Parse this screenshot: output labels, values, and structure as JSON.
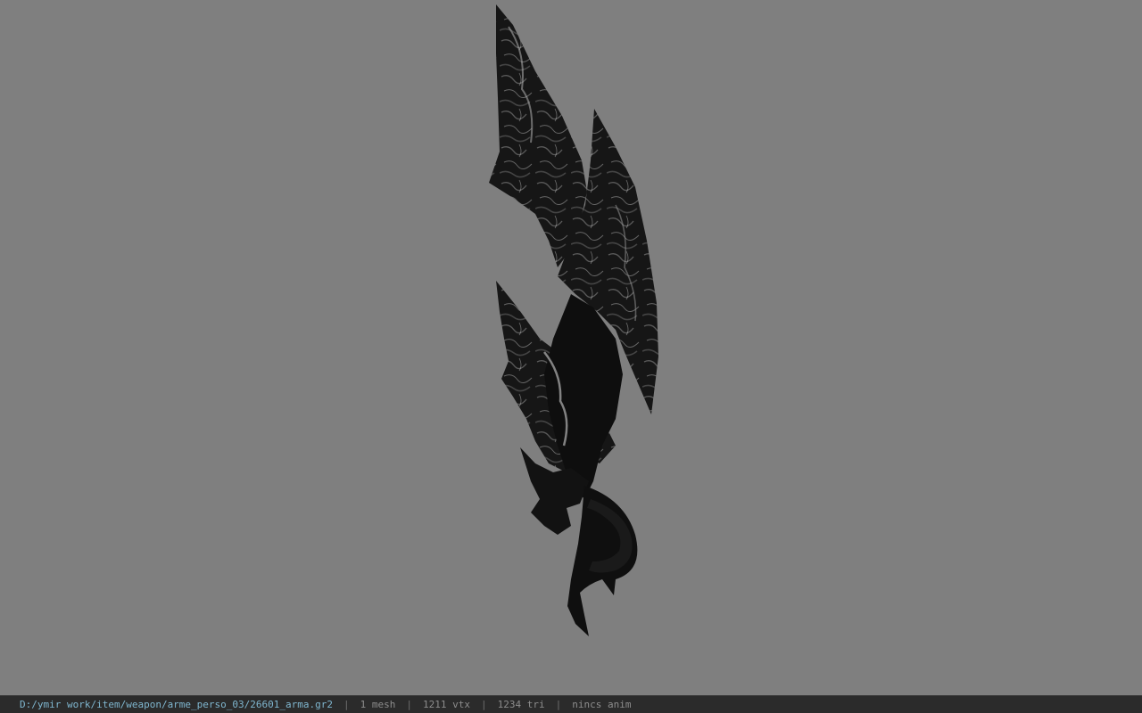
{
  "viewer": {
    "background_color": "#7f7f7f",
    "model_icon": "sword-model"
  },
  "status": {
    "file_path": "D:/ymir work/item/weapon/arme_perso_03/26601_arma.gr2",
    "separator": "|",
    "mesh": "1 mesh",
    "vertices": "1211 vtx",
    "triangles": "1234 tri",
    "animation": "nincs anim"
  }
}
